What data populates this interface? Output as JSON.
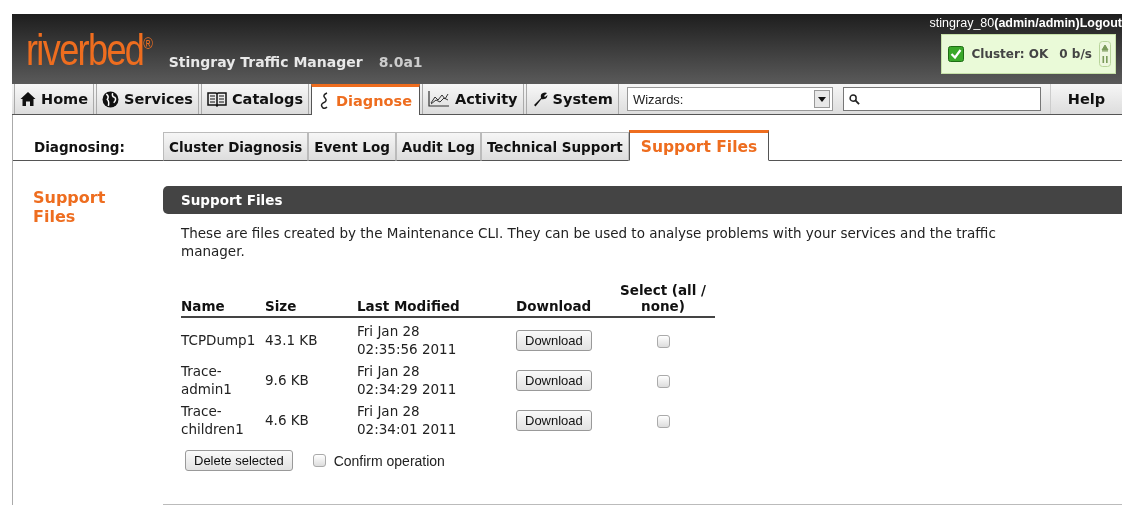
{
  "header": {
    "logo": "riverbed$^{®}$",
    "product": "Stingray Traffic Manager",
    "version": "8.0a1",
    "user": "stingray_80",
    "login": "(admin/admin)",
    "logout": "Logout",
    "cluster": {
      "status": "Cluster: OK",
      "rate": "0 b/s"
    }
  },
  "nav": {
    "tabs": [
      {
        "label": "Home",
        "selected": false
      },
      {
        "label": "Services",
        "selected": false
      },
      {
        "label": "Catalogs",
        "selected": false
      },
      {
        "label": "Diagnose",
        "selected": true
      },
      {
        "label": "Activity",
        "selected": false
      },
      {
        "label": "System",
        "selected": false
      }
    ],
    "wizards": {
      "value": "Wizards:"
    },
    "help": "Help"
  },
  "subnav": {
    "label": "Diagnosing:",
    "tabs": [
      {
        "label": "Cluster Diagnosis",
        "selected": false
      },
      {
        "label": "Event Log",
        "selected": false
      },
      {
        "label": "Audit Log",
        "selected": false
      },
      {
        "label": "Technical Support",
        "selected": false
      },
      {
        "label": "Support Files",
        "selected": true
      }
    ]
  },
  "sidebar": {
    "title": "Support Files"
  },
  "section": {
    "title": "Support Files",
    "description": "These are files created by the Maintenance CLI. They can be used to analyse problems with your services and the traffic manager.",
    "table": {
      "columns": [
        "Name",
        "Size",
        "Last Modified",
        "Download",
        "Select (all / none)"
      ],
      "rows": [
        {
          "name": "TCPDump1",
          "size": "43.1 KB",
          "modified": "Fri Jan 28 02:35:56 2011",
          "button": "Download",
          "checked": false
        },
        {
          "name": "Trace-admin1",
          "size": "9.6 KB",
          "modified": "Fri Jan 28 02:34:29 2011",
          "button": "Download",
          "checked": false
        },
        {
          "name": "Trace-children1",
          "size": "4.6 KB",
          "modified": "Fri Jan 28 02:34:01 2011",
          "button": "Download",
          "checked": false
        }
      ]
    },
    "delete_button": "Delete selected",
    "confirm": {
      "label": "Confirm operation",
      "checked": false
    }
  }
}
